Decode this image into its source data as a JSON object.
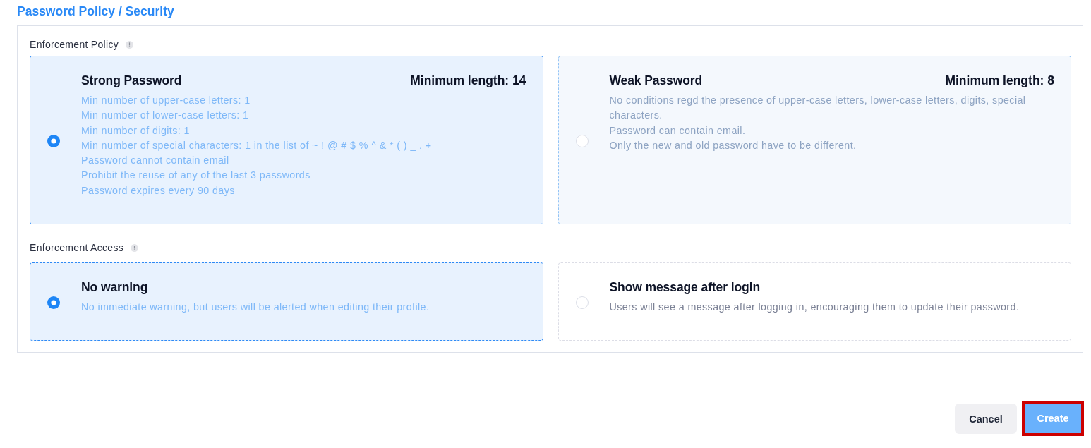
{
  "page": {
    "title": "Password Policy / Security"
  },
  "sections": [
    {
      "label": "Enforcement Policy",
      "options": [
        {
          "title": "Strong Password",
          "min_length": "Minimum length: 14",
          "lines": [
            "Min number of upper-case letters: 1",
            "Min number of lower-case letters: 1",
            "Min number of digits: 1",
            "Min number of special characters: 1 in the list of ~ ! @ # $ % ^ & * ( ) _ . +",
            "Password cannot contain email",
            "Prohibit the reuse of any of the last 3 passwords",
            "Password expires every 90 days"
          ],
          "selected": true,
          "hovered": false
        },
        {
          "title": "Weak Password",
          "min_length": "Minimum length: 8",
          "lines": [
            "No conditions regd the presence of upper-case letters, lower-case letters, digits, special characters.",
            "Password can contain email.",
            "Only the new and old password have to be different."
          ],
          "selected": false,
          "hovered": true
        }
      ]
    },
    {
      "label": "Enforcement Access",
      "options": [
        {
          "title": "No warning",
          "lines": [
            "No immediate warning, but users will be alerted when editing their profile."
          ],
          "selected": true,
          "hovered": false
        },
        {
          "title": "Show message after login",
          "lines": [
            "Users will see a message after logging in, encouraging them to update their password."
          ],
          "selected": false,
          "hovered": false
        }
      ]
    }
  ],
  "buttons": [
    {
      "label": "Cancel",
      "kind": "secondary",
      "highlighted": false
    },
    {
      "label": "Create",
      "kind": "primary",
      "highlighted": true
    }
  ]
}
